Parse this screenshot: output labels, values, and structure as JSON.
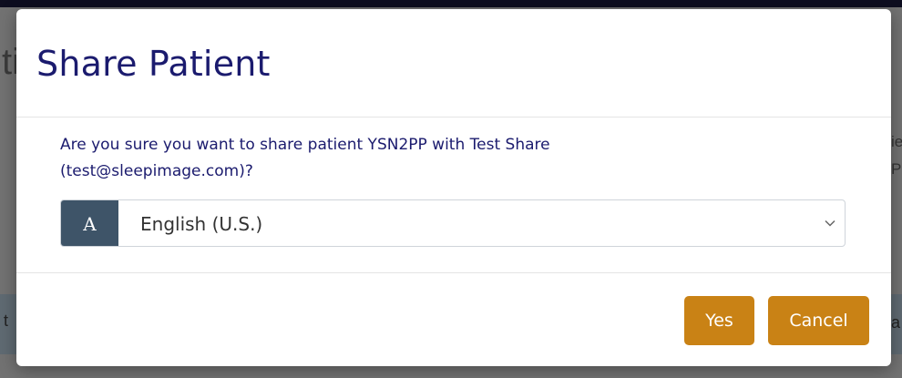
{
  "background": {
    "title_fragment": "ti",
    "right_fragment_1": "ie",
    "right_fragment_2": "P",
    "row_fragment_left": "t",
    "row_fragment_right": "a"
  },
  "modal": {
    "title": "Share Patient",
    "message_line1": "Are you sure you want to share patient YSN2PP with Test Share",
    "message_line2": "(test@sleepimage.com)?",
    "language": {
      "addon_icon": "A",
      "selected": "English (U.S.)"
    },
    "buttons": {
      "yes_label": "Yes",
      "cancel_label": "Cancel"
    }
  },
  "colors": {
    "title": "#1b1b6e",
    "accent_button": "#c98215",
    "addon_bg": "#3e5468",
    "overlay": "#727272"
  }
}
